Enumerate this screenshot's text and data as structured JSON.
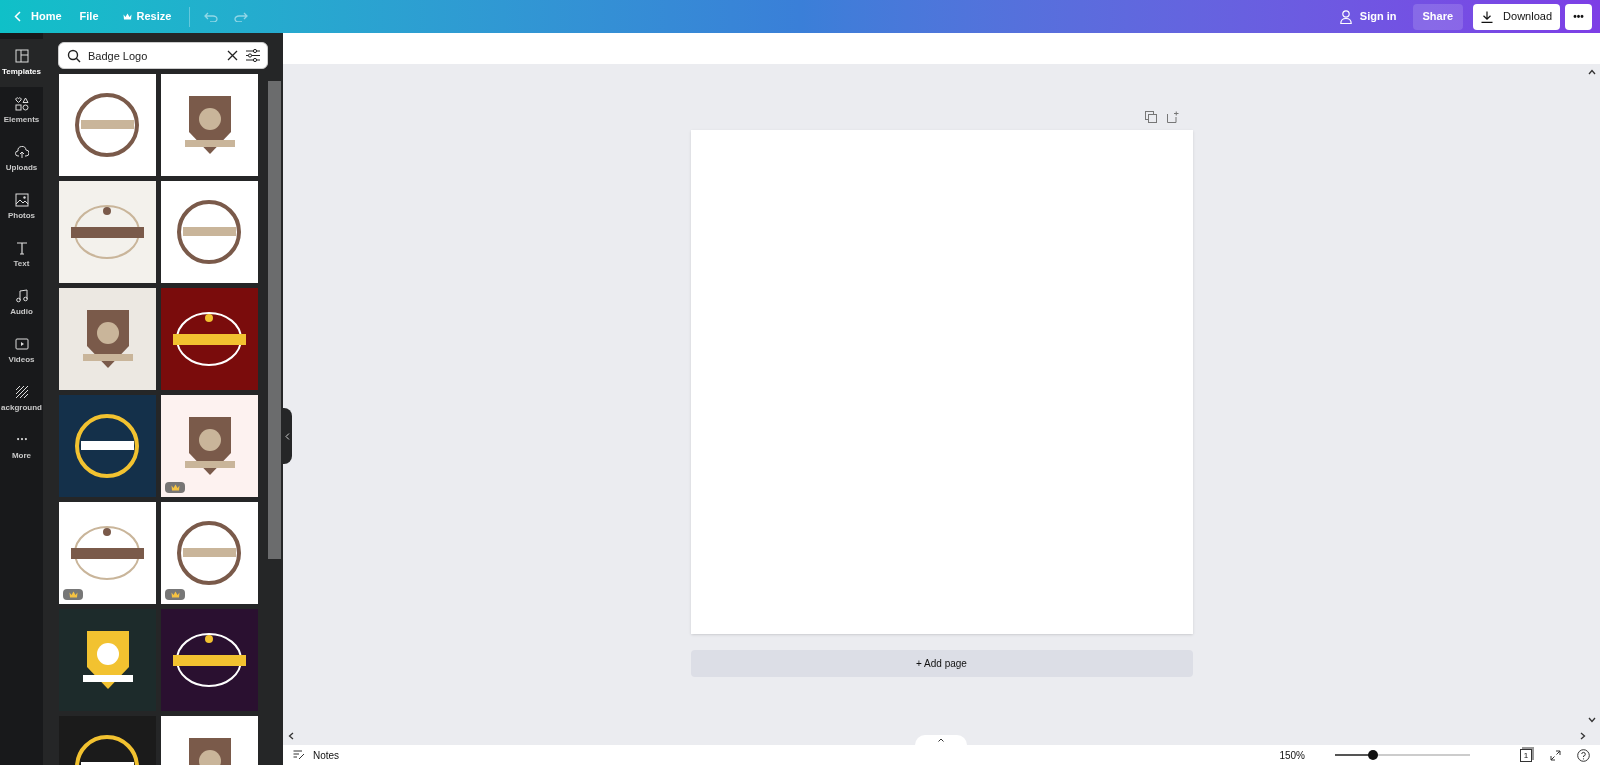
{
  "topbar": {
    "back": "Home",
    "menus": [
      {
        "label": "File"
      },
      {
        "label": "Resize",
        "premium": true
      }
    ],
    "sign_in": "Sign in",
    "share": "Share",
    "download": "Download",
    "more": "•••"
  },
  "rail": [
    {
      "label": "Templates",
      "kind": "templates",
      "selected": true
    },
    {
      "label": "Elements",
      "kind": "elements",
      "selected": false
    },
    {
      "label": "Uploads",
      "kind": "uploads",
      "selected": false
    },
    {
      "label": "Photos",
      "kind": "photos",
      "selected": false
    },
    {
      "label": "Text",
      "kind": "text",
      "selected": false
    },
    {
      "label": "Audio",
      "kind": "audio",
      "selected": false
    },
    {
      "label": "Videos",
      "kind": "videos",
      "selected": false
    },
    {
      "label": "ackground",
      "kind": "background",
      "selected": false
    },
    {
      "label": "More",
      "kind": "more",
      "selected": false
    }
  ],
  "search": {
    "value": "Badge Logo"
  },
  "templates": [
    {
      "color": "#ffffff"
    },
    {
      "color": "#ffffff"
    },
    {
      "color": "#f3f1ec"
    },
    {
      "color": "#ffffff"
    },
    {
      "color": "#ece8e2"
    },
    {
      "color": "#7a0c0c"
    },
    {
      "color": "#14304a"
    },
    {
      "color": "#fdf2f0",
      "premium": true
    },
    {
      "color": "#ffffff",
      "premium": true
    },
    {
      "color": "#ffffff",
      "premium": true
    },
    {
      "color": "#1d2b2b"
    },
    {
      "color": "#2a1030"
    },
    {
      "color": "#1b1b1b"
    },
    {
      "color": "#ffffff"
    }
  ],
  "add_page": "+ Add page",
  "footer": {
    "notes": "Notes",
    "zoom": "150%",
    "zoom_level": {
      "level": 0.28
    },
    "page_count": "1"
  }
}
